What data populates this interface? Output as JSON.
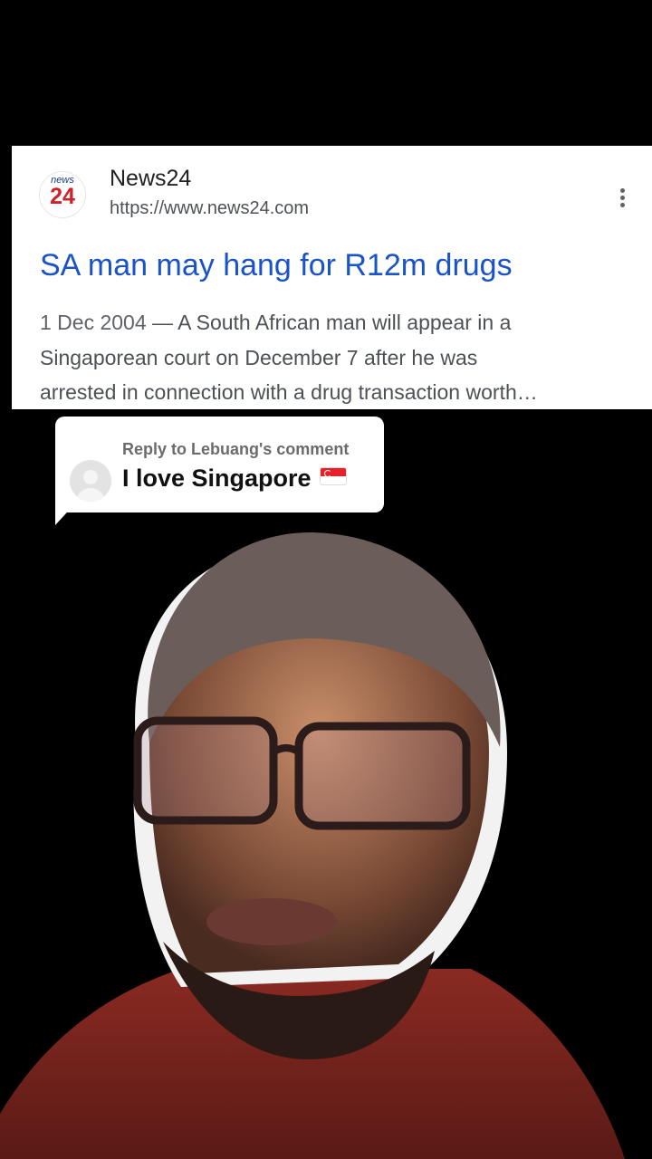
{
  "result": {
    "logo_top": "news",
    "logo_number": "24",
    "site_name": "News24",
    "url": "https://www.news24.com",
    "headline": "SA man may hang for R12m drugs",
    "date": "1 Dec 2004",
    "snippet_line1": " — A South African man will appear in a",
    "snippet_line2": "Singaporean court on December 7 after he was",
    "snippet_line3": "arrested in connection with a drug transaction worth…"
  },
  "comment": {
    "reply_to": "Reply to Lebuang's comment",
    "text": "I love Singapore"
  },
  "colors": {
    "link": "#1a53c7",
    "logo_red": "#d0202a",
    "background": "#000000"
  }
}
